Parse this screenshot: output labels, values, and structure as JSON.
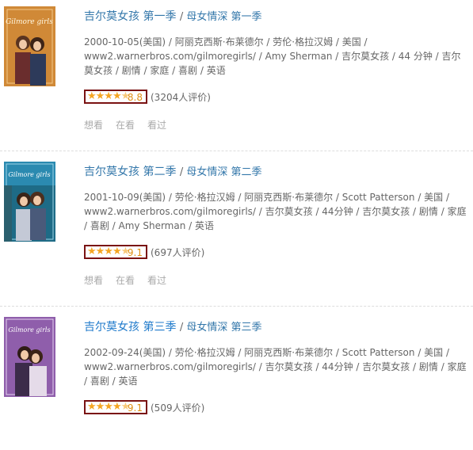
{
  "items": [
    {
      "title": "吉尔莫女孩 第一季",
      "alt_title": "母女情深 第一季",
      "meta": "2000-10-05(美国) / 阿丽克西斯·布莱德尔 / 劳伦·格拉汉姆 / 美国 / www2.warnerbros.com/gilmoregirls/ / Amy Sherman / 吉尔莫女孩 / 44 分钟 / 吉尔莫女孩 / 剧情 / 家庭 / 喜剧 / 英语",
      "score": "8.8",
      "votes": "(3204人评价)",
      "stars": 4.5,
      "poster_label": "Gilmore girls",
      "accent": "#b8651e"
    },
    {
      "title": "吉尔莫女孩 第二季",
      "alt_title": "母女情深 第二季",
      "meta": "2001-10-09(美国) / 劳伦·格拉汉姆 / 阿丽克西斯·布莱德尔 / Scott Patterson / 美国 / www2.warnerbros.com/gilmoregirls/ / 吉尔莫女孩 / 44分钟 / 吉尔莫女孩 / 剧情 / 家庭 / 喜剧 / Amy Sherman / 英语",
      "score": "9.1",
      "votes": "(697人评价)",
      "stars": 4.5,
      "poster_label": "Gilmore girls",
      "accent": "#1f6f8b"
    },
    {
      "title": "吉尔莫女孩 第三季",
      "alt_title": "母女情深 第三季",
      "meta": "2002-09-24(美国) / 劳伦·格拉汉姆 / 阿丽克西斯·布莱德尔 / Scott Patterson / 美国 / www2.warnerbros.com/gilmoregirls/ / 吉尔莫女孩 / 44分钟 / 吉尔莫女孩 / 剧情 / 家庭 / 喜剧 / 英语",
      "score": "9.1",
      "votes": "(509人评价)",
      "stars": 4.5,
      "poster_label": "Gilmore girls",
      "accent": "#8a4fa6"
    }
  ],
  "actions": {
    "want": "想看",
    "watching": "在看",
    "watched": "看过"
  }
}
